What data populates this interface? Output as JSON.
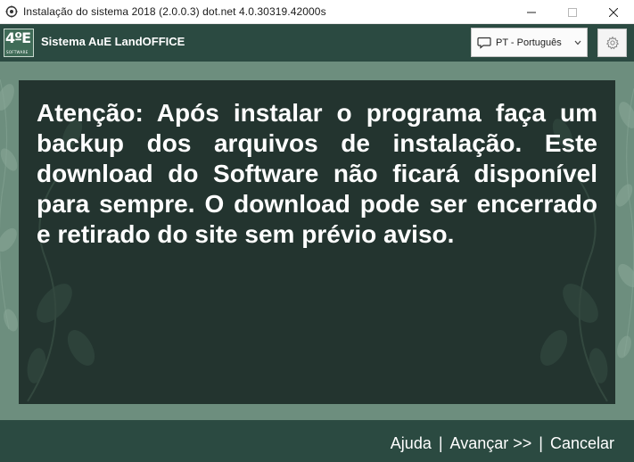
{
  "window": {
    "title": "Instalação do sistema 2018 (2.0.0.3)  dot.net 4.0.30319.42000s",
    "icon": "gear-app-icon",
    "controls": [
      "minimize-icon",
      "maximize-icon",
      "close-icon"
    ]
  },
  "header": {
    "logo_text": "4ºE",
    "logo_subtext": "SOFTWARE",
    "app_name": "Sistema AuE LandOFFICE",
    "language": {
      "selected": "PT - Português",
      "icon": "chat-bubble-icon"
    },
    "settings_icon": "gear-icon"
  },
  "main": {
    "message": "Atenção: Após instalar o programa faça um backup dos arquivos de instalação. Este download do Software não ficará disponível para sempre. O download pode ser encerrado e retirado do site sem prévio aviso."
  },
  "footer": {
    "help": "Ajuda",
    "next": "Avançar >>",
    "cancel": "Cancelar",
    "separator": "|"
  },
  "colors": {
    "header_bg": "#2b4a41",
    "frame_bg": "#6d8e7e",
    "panel_bg": "#23342f",
    "text": "#ffffff"
  }
}
